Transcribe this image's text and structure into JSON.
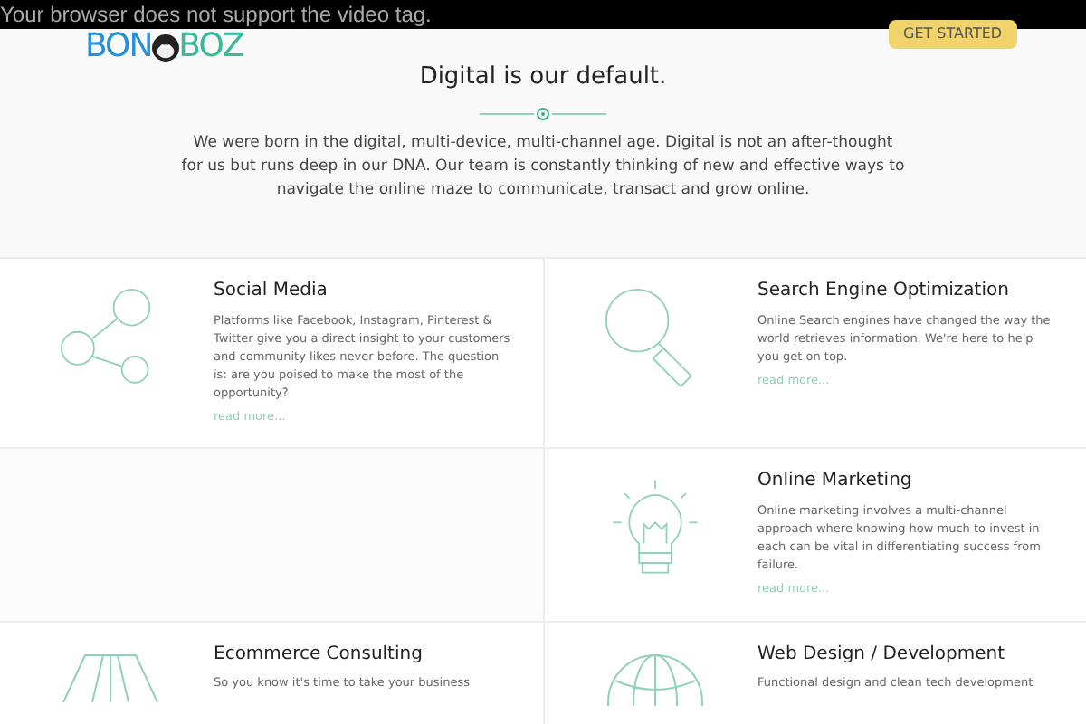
{
  "video_fallback": "Your browser does not support the video tag.",
  "logo": {
    "before": "BON",
    "after": "BOZ"
  },
  "cta_button": "GET STARTED",
  "intro": {
    "title": "Digital is our default.",
    "text": "We were born in the digital, multi-device, multi-channel age. Digital is not an after-thought for us but runs deep in our DNA. Our team is constantly thinking of new and effective ways to navigate the online maze to communicate, transact and grow online."
  },
  "rows": [
    {
      "left": {
        "kind": "share",
        "title": "Social Media",
        "text": "Platforms like Facebook, Instagram, Pinterest & Twitter give you a direct insight to your customers and community likes never before. The question is: are you poised to make the most of the opportunity?",
        "link": "read more..."
      },
      "right": {
        "kind": "search",
        "title": "Search Engine Optimization",
        "text": "Online Search engines have changed the way the world retrieves information. We're here to help you get on top.",
        "link": "read more..."
      }
    },
    {
      "right": {
        "kind": "bulb",
        "title": "Online Marketing",
        "text": "Online marketing involves a multi-channel approach where knowing how much to invest in each can be vital in differentiating success from failure.",
        "link": "read more..."
      }
    },
    {
      "left": {
        "kind": "cart",
        "title": "Ecommerce Consulting",
        "text": "So you know it's time to take your business"
      },
      "right": {
        "kind": "globe",
        "title": "Web Design / Development",
        "text": "Functional design and clean tech development"
      }
    }
  ]
}
